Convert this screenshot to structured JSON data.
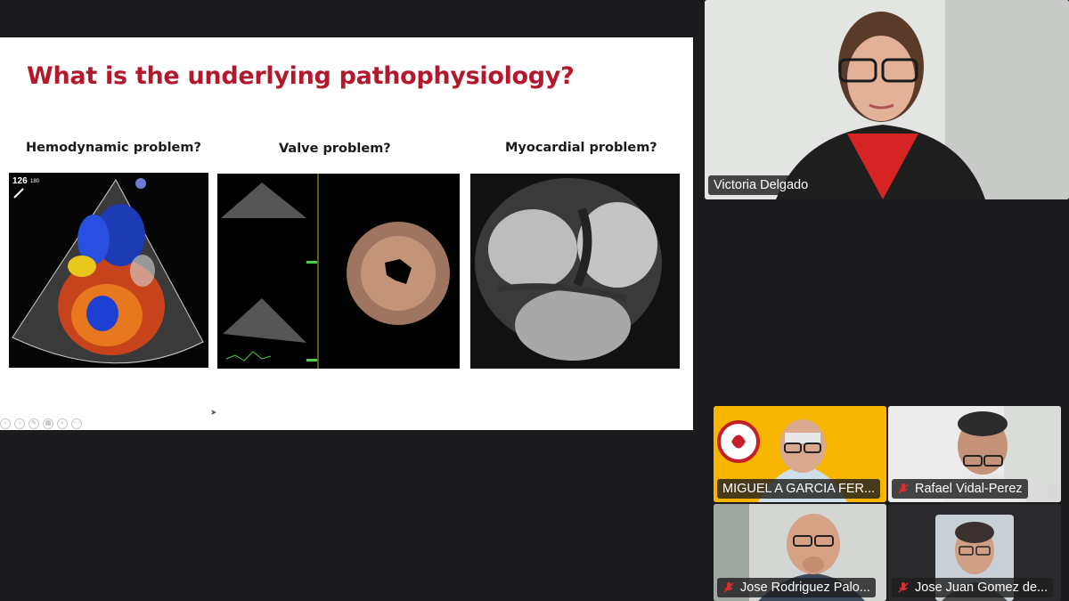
{
  "slide": {
    "title": "What is the underlying pathophysiology?",
    "labels": [
      "Hemodynamic problem?",
      "Valve problem?",
      "Myocardial problem?"
    ],
    "echo_angle_main": "126",
    "echo_angle_sub": "180"
  },
  "speaker": {
    "name": "Victoria Delgado"
  },
  "participants": [
    {
      "name": "MIGUEL A GARCIA FER...",
      "muted": false
    },
    {
      "name": "Rafael Vidal-Perez",
      "muted": true
    },
    {
      "name": "Jose Rodriguez Palo...",
      "muted": true
    },
    {
      "name": "Jose Juan Gomez de...",
      "muted": true
    }
  ],
  "colors": {
    "title": "#b3182d",
    "mute": "#e02d2d",
    "tile_yellow": "#f7b500"
  }
}
